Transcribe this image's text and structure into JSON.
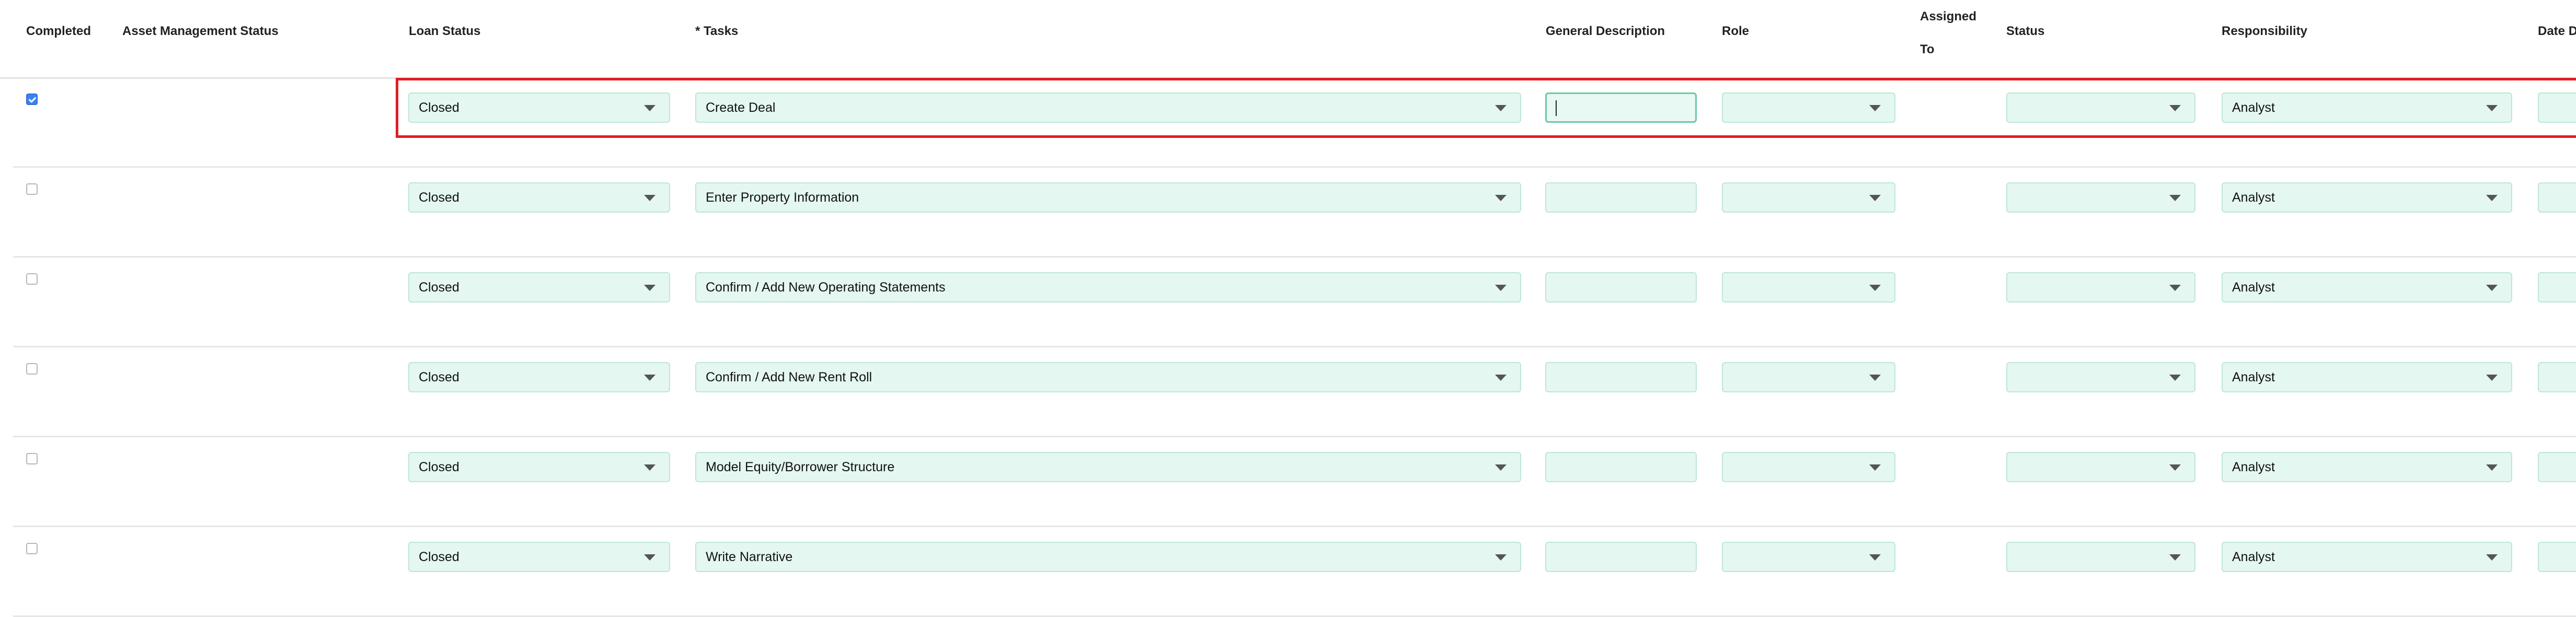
{
  "table": {
    "headers": {
      "completed": "Completed",
      "asset_management_status": "Asset Management Status",
      "loan_status": "Loan Status",
      "tasks": "* Tasks",
      "general_description": "General Description",
      "role": "Role",
      "assigned_to": "Assigned To",
      "status": "Status",
      "responsibility": "Responsibility",
      "date": "Date D"
    },
    "rows": [
      {
        "completed": true,
        "loan_status": "Closed",
        "task": "Create Deal",
        "general_description": "",
        "role": "",
        "status": "",
        "responsibility": "Analyst"
      },
      {
        "completed": false,
        "loan_status": "Closed",
        "task": "Enter Property Information",
        "general_description": "",
        "role": "",
        "status": "",
        "responsibility": "Analyst"
      },
      {
        "completed": false,
        "loan_status": "Closed",
        "task": "Confirm / Add New Operating Statements",
        "general_description": "",
        "role": "",
        "status": "",
        "responsibility": "Analyst"
      },
      {
        "completed": false,
        "loan_status": "Closed",
        "task": "Confirm / Add New Rent Roll",
        "general_description": "",
        "role": "",
        "status": "",
        "responsibility": "Analyst"
      },
      {
        "completed": false,
        "loan_status": "Closed",
        "task": "Model Equity/Borrower Structure",
        "general_description": "",
        "role": "",
        "status": "",
        "responsibility": "Analyst"
      },
      {
        "completed": false,
        "loan_status": "Closed",
        "task": "Write Narrative",
        "general_description": "",
        "role": "",
        "status": "",
        "responsibility": "Analyst"
      }
    ]
  },
  "colors": {
    "field_background": "#e4f7f1",
    "field_border": "#bfe5d8",
    "highlight_border": "#e31b23",
    "checkbox_checked": "#3b82f6"
  },
  "icons": {
    "dropdown": "chevron-down-icon",
    "checkbox": "checkbox-icon"
  }
}
